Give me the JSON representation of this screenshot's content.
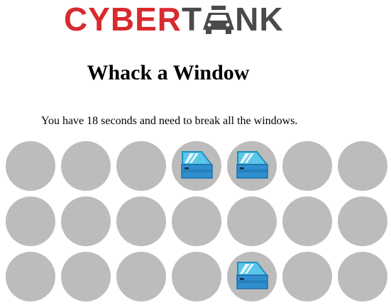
{
  "logo": {
    "part1": "CYBER",
    "part2": "T",
    "part3": "NK",
    "colors": {
      "red": "#d72b2f",
      "dark": "#4a4a4a"
    }
  },
  "title": "Whack a Window",
  "instructions": "You have 18 seconds and need to break all the windows.",
  "grid": {
    "rows": 3,
    "cols": 7,
    "hole_color": "#bcbcbc",
    "windows": [
      [
        false,
        false,
        false,
        true,
        true,
        false,
        false
      ],
      [
        false,
        false,
        false,
        false,
        false,
        false,
        false
      ],
      [
        false,
        false,
        false,
        false,
        true,
        false,
        false
      ]
    ],
    "window_icon": "car-window-icon"
  }
}
